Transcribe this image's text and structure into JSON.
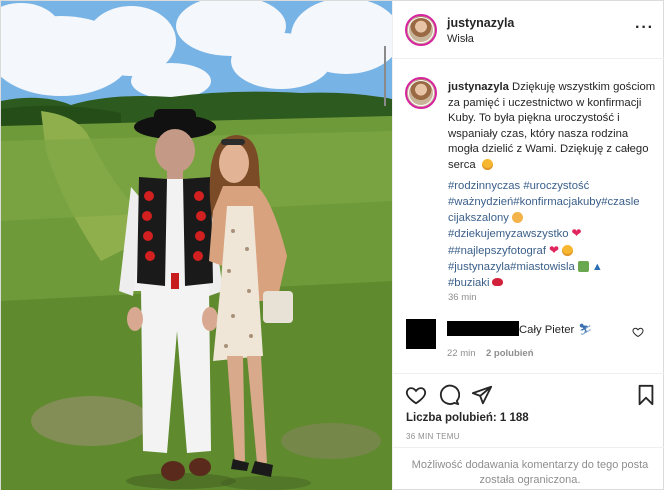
{
  "post": {
    "author": {
      "username": "justynazyla",
      "location": "Wisła"
    },
    "header": {
      "more_icon": "more-options-icon"
    },
    "caption": {
      "username": "justynazyla",
      "text": "Dziękuję wszystkim gościom za pamięć i uczestnictwo w konfirmacji Kuby. To była piękna uroczystość i wspaniały czas, który nasza rodzina mogła dzielić z Wami. Dziękuję z całego serca",
      "hashtag_lines": [
        "#rodzinnyczas #uroczystość",
        "#ważnydzień#konfirmacjakuby#czasle",
        "cijakszalony",
        "#dziekujemyzawszystko",
        "##najlepszyfotograf",
        "#justynazyla#miastowisla",
        "#buziaki"
      ],
      "time": "36 min"
    },
    "comment": {
      "text": "Cały Pieter",
      "time": "22 min",
      "likes": "2 polubień"
    },
    "actions": {
      "likes_label": "Liczba polubień: 1 188",
      "posted_ago": "36 MIN TEMU"
    },
    "footer": {
      "notice": "Możliwość dodawania komentarzy do tego posta została ograniczona."
    }
  },
  "colors": {
    "border": "#dbdbdb",
    "text": "#262626",
    "muted": "#8e8e8e",
    "hashtag": "#3b5f8a",
    "story_ring": "#d6249f"
  }
}
